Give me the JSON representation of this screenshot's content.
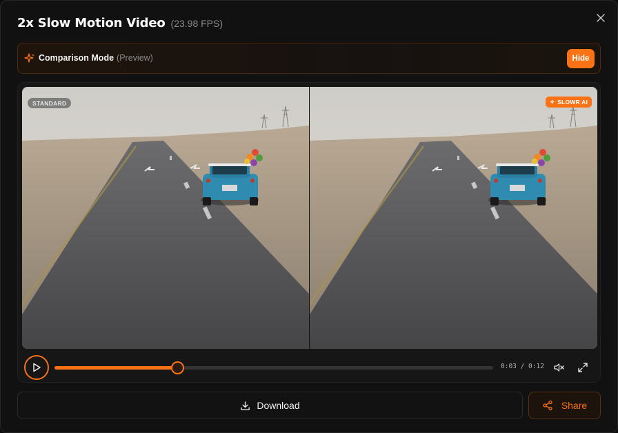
{
  "modal": {
    "title": "2x Slow Motion Video",
    "fps": "(23.98 FPS)"
  },
  "compare_bar": {
    "label": "Comparison Mode",
    "sub": "(Preview)",
    "hide_label": "Hide"
  },
  "video": {
    "left_badge": "STANDARD",
    "right_badge": "SLOWR AI"
  },
  "controls": {
    "progress": 0.28,
    "time": "0:03 / 0:12"
  },
  "actions": {
    "download_label": "Download",
    "share_label": "Share"
  },
  "icons": {
    "close": "close-icon",
    "compare": "sparkle-icon",
    "play": "play-icon",
    "mute": "volume-muted-icon",
    "fullscreen": "expand-icon",
    "download": "download-icon",
    "share": "share-icon"
  },
  "colors": {
    "accent": "#f97316",
    "background": "#111111"
  }
}
